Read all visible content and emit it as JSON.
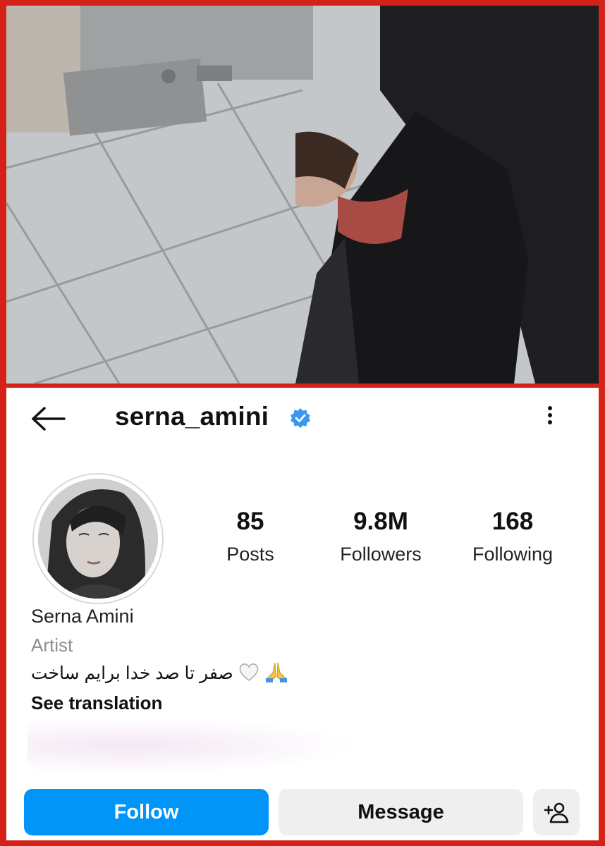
{
  "profile": {
    "username": "serna_amini",
    "verified": true,
    "full_name": "Serna Amini",
    "category": "Artist",
    "bio": "صفر تا صد خدا برایم ساخت",
    "see_translation": "See translation",
    "stats": {
      "posts_value": "85",
      "posts_label": "Posts",
      "followers_value": "9.8M",
      "followers_label": "Followers",
      "following_value": "168",
      "following_label": "Following"
    },
    "actions": {
      "follow_label": "Follow",
      "message_label": "Message"
    }
  },
  "icons": {
    "back": "back-arrow-icon",
    "verified": "verified-badge-icon",
    "more": "more-options-icon",
    "add_user": "add-person-icon"
  },
  "colors": {
    "frame": "#d42218",
    "follow_button": "#0095f6",
    "secondary_button": "#efefef",
    "verified_badge": "#3897f0"
  }
}
